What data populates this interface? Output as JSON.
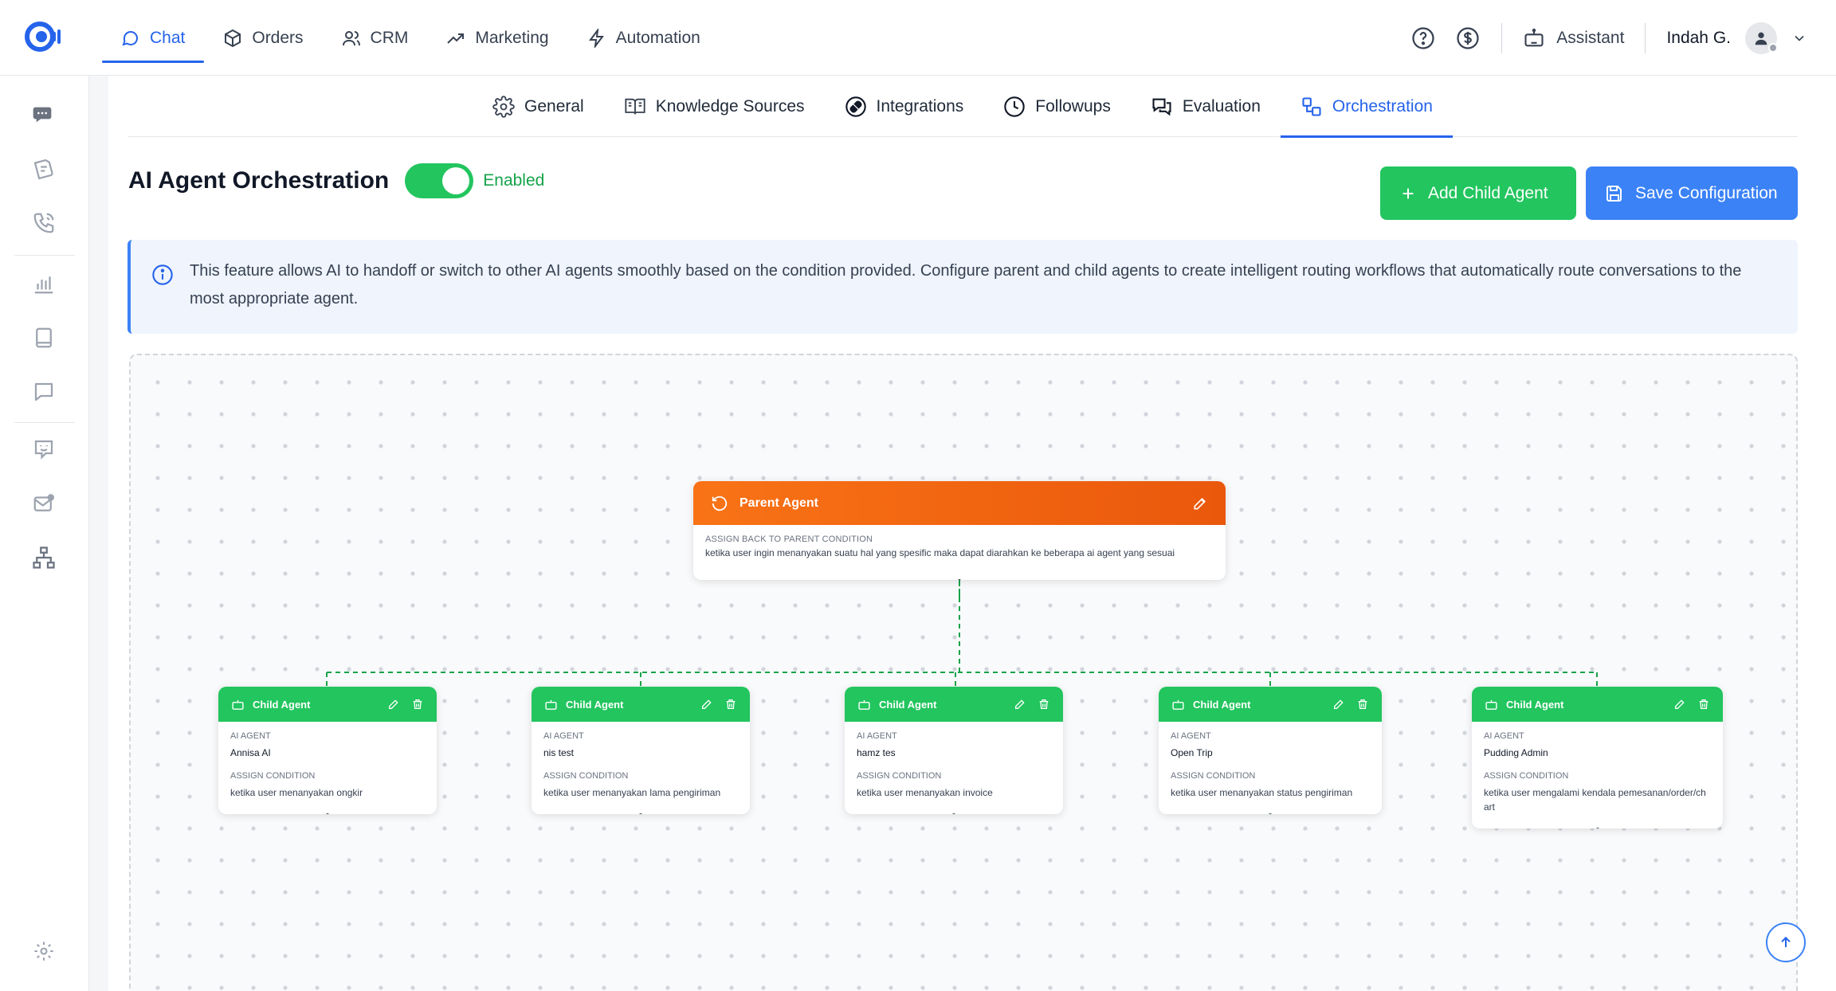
{
  "nav": {
    "items": [
      {
        "label": "Chat",
        "icon": "chat-bubble-icon",
        "active": true
      },
      {
        "label": "Orders",
        "icon": "box-icon"
      },
      {
        "label": "CRM",
        "icon": "users-icon"
      },
      {
        "label": "Marketing",
        "icon": "trending-up-icon"
      },
      {
        "label": "Automation",
        "icon": "lightning-icon"
      }
    ],
    "assistant_label": "Assistant",
    "user_name": "Indah G."
  },
  "subtabs": [
    {
      "label": "General",
      "icon": "gear-icon"
    },
    {
      "label": "Knowledge Sources",
      "icon": "book-icon"
    },
    {
      "label": "Integrations",
      "icon": "plug-icon"
    },
    {
      "label": "Followups",
      "icon": "clock-icon"
    },
    {
      "label": "Evaluation",
      "icon": "chat-bubbles-icon"
    },
    {
      "label": "Orchestration",
      "icon": "flow-icon",
      "active": true
    }
  ],
  "page": {
    "title": "AI Agent Orchestration",
    "toggle_label": "Enabled",
    "add_child_label": "Add Child Agent",
    "save_label": "Save Configuration",
    "info_text": "This feature allows AI to handoff or switch to other AI agents smoothly based on the condition provided. Configure parent and child agents to create intelligent routing workflows that automatically route conversations to the most appropriate agent."
  },
  "parent": {
    "title": "Parent Agent",
    "condition_label": "ASSIGN BACK TO PARENT CONDITION",
    "condition": "ketika user ingin menanyakan suatu hal yang spesific maka dapat diarahkan ke beberapa ai agent yang sesuai"
  },
  "children": [
    {
      "title": "Child Agent",
      "agent_label": "AI AGENT",
      "agent": "Annisa AI",
      "condition_label": "ASSIGN CONDITION",
      "condition": "ketika user menanyakan ongkir"
    },
    {
      "title": "Child Agent",
      "agent_label": "AI AGENT",
      "agent": "nis test",
      "condition_label": "ASSIGN CONDITION",
      "condition": "ketika user menanyakan lama pengiriman"
    },
    {
      "title": "Child Agent",
      "agent_label": "AI AGENT",
      "agent": "hamz tes",
      "condition_label": "ASSIGN CONDITION",
      "condition": "ketika user menanyakan invoice"
    },
    {
      "title": "Child Agent",
      "agent_label": "AI AGENT",
      "agent": "Open Trip",
      "condition_label": "ASSIGN CONDITION",
      "condition": "ketika user menanyakan status pengiriman"
    },
    {
      "title": "Child Agent",
      "agent_label": "AI AGENT",
      "agent": "Pudding Admin",
      "condition_label": "ASSIGN CONDITION",
      "condition": "ketika user mengalami kendala pemesanan/order/chart"
    }
  ],
  "colors": {
    "primary": "#2563eb",
    "success": "#22c55e",
    "parent_header": "#f97316"
  }
}
